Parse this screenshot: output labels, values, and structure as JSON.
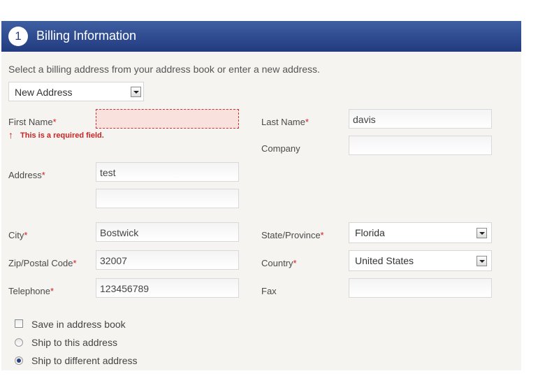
{
  "header": {
    "step": "1",
    "title": "Billing Information"
  },
  "instructions": "Select a billing address from your address book or enter a new address.",
  "address_select": {
    "value": "New Address"
  },
  "required_mark": "*",
  "fields": {
    "first_name": {
      "label": "First Name",
      "value": ""
    },
    "last_name": {
      "label": "Last Name",
      "value": "davis"
    },
    "company": {
      "label": "Company",
      "value": ""
    },
    "address": {
      "label": "Address",
      "line1": "test",
      "line2": ""
    },
    "city": {
      "label": "City",
      "value": "Bostwick"
    },
    "state": {
      "label": "State/Province",
      "value": "Florida"
    },
    "zip": {
      "label": "Zip/Postal Code",
      "value": "32007"
    },
    "country": {
      "label": "Country",
      "value": "United States"
    },
    "telephone": {
      "label": "Telephone",
      "value": "123456789"
    },
    "fax": {
      "label": "Fax",
      "value": ""
    }
  },
  "error": {
    "arrow": "↑",
    "message": "This is a required field."
  },
  "options": {
    "save_in_address_book": {
      "label": "Save in address book",
      "checked": false
    },
    "ship_to_this": {
      "label": "Ship to this address",
      "checked": false
    },
    "ship_to_different": {
      "label": "Ship to different address",
      "checked": true
    }
  }
}
